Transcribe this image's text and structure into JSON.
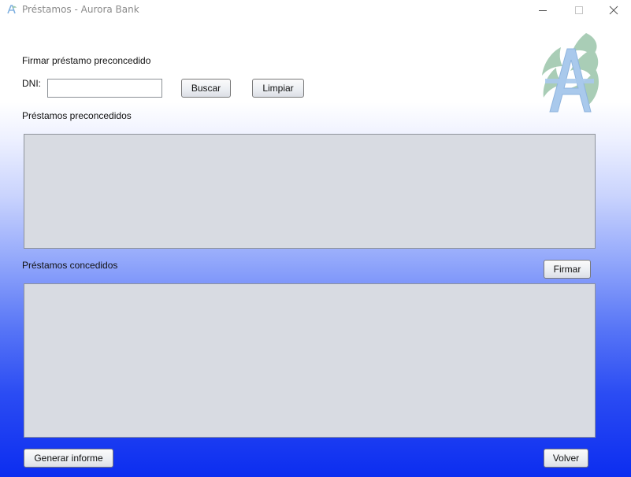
{
  "window": {
    "title": "Préstamos - Aurora Bank"
  },
  "header": {
    "section_title": "Firmar préstamo preconcedido",
    "dni_label": "DNI:",
    "dni_value": "",
    "search_label": "Buscar",
    "clear_label": "Limpiar"
  },
  "preapproved": {
    "title": "Préstamos preconcedidos"
  },
  "granted": {
    "title": "Préstamos concedidos",
    "sign_label": "Firmar"
  },
  "footer": {
    "report_label": "Generar informe",
    "back_label": "Volver"
  },
  "icons": {
    "app": "aurora-bank-logo-icon",
    "minimize": "minimize-icon",
    "maximize": "maximize-icon",
    "close": "close-icon",
    "logo": "aurora-bank-logo"
  },
  "colors": {
    "gradient_top": "#ffffff",
    "gradient_bottom": "#0c2df0",
    "panel_bg": "#d8dbe2",
    "logo_green": "#a9cdb6",
    "logo_blue": "#a9c9ec"
  }
}
